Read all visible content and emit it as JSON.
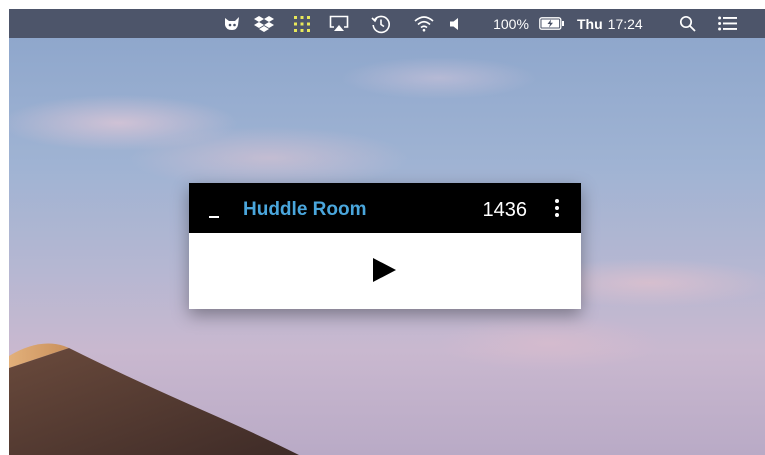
{
  "menubar": {
    "battery_percent": "100%",
    "clock_day": "Thu",
    "clock_time": "17:24",
    "icons": [
      "cat-app-icon",
      "dropbox-icon",
      "grid-app-icon",
      "airplay-icon",
      "time-machine-icon",
      "wifi-icon",
      "volume-icon",
      "battery-charging-icon",
      "spotlight-search-icon",
      "notification-center-icon"
    ]
  },
  "widget": {
    "room_name": "Huddle Room",
    "room_number": "1436",
    "colors": {
      "header_bg": "#000000",
      "room_name": "#4aa6dc",
      "body_bg": "#ffffff"
    }
  }
}
